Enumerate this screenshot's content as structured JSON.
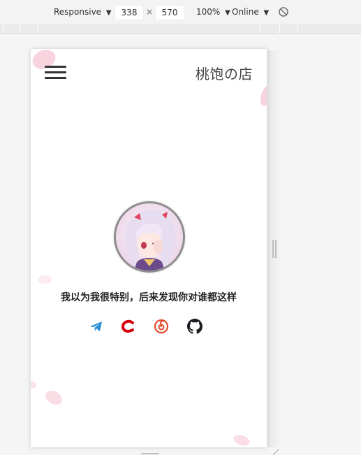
{
  "devtools": {
    "device_mode": "Responsive",
    "width": "338",
    "times": "×",
    "height": "570",
    "zoom": "100%",
    "network": "Online",
    "dropdown_arrow": "▼"
  },
  "site": {
    "title": "桃饱の店",
    "motto": "我以为我很特别，后来发现你对谁都这样"
  },
  "icons": {
    "menu": "hamburger-menu-icon",
    "socials": [
      "telegram-icon",
      "csdn-icon",
      "netease-music-icon",
      "github-icon"
    ]
  },
  "colors": {
    "telegram": "#2a8fd4",
    "csdn": "#d7000f",
    "netease": "#e4492f",
    "github": "#1b1f23",
    "petal": "#f6c6d3"
  }
}
